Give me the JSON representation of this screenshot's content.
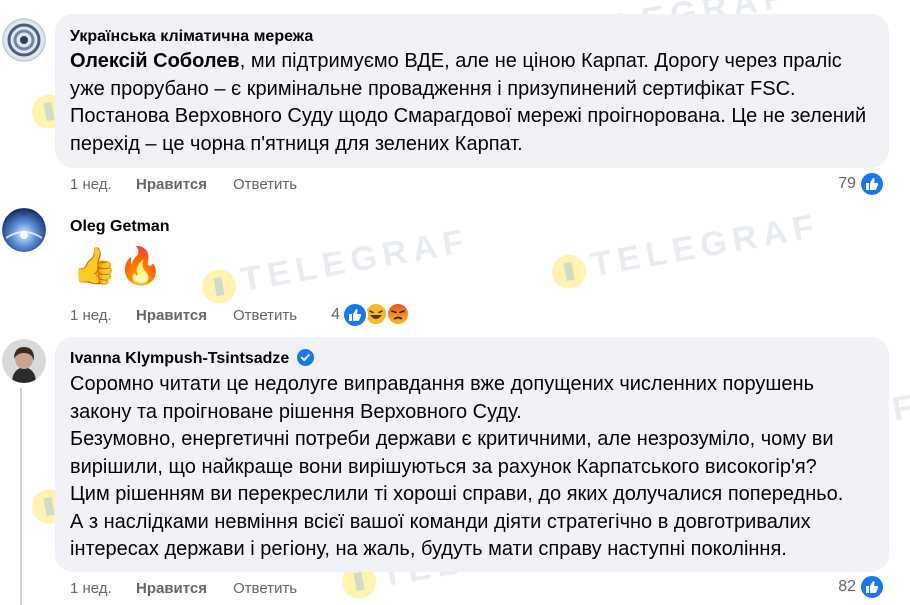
{
  "comments": [
    {
      "author": "Українська кліматична мережа",
      "mention": "Олексій Соболев",
      "text_after_mention": ", ми підтримуємо ВДЕ, але не ціною Карпат. Дорогу через праліс уже прорубано – є кримінальне провадження і призупинений сертифікат FSC. Постанова Верховного Суду щодо Смарагдової мережі проігнорована. Це не зелений перехід – це чорна п'ятниця для зелених Карпат.",
      "time": "1 нед.",
      "like_label": "Нравится",
      "reply_label": "Ответить",
      "reactions_count": "79",
      "reactions": [
        "like-icon"
      ]
    },
    {
      "author": "Oleg Getman",
      "emojis": [
        "👍",
        "🔥"
      ],
      "time": "1 нед.",
      "like_label": "Нравится",
      "reply_label": "Ответить",
      "reactions_count": "4",
      "reactions": [
        "like-icon",
        "haha-icon",
        "angry-icon"
      ]
    },
    {
      "author": "Ivanna Klympush-Tsintsadze",
      "verified": true,
      "paragraphs": [
        "Соромно читати це недолуге виправдання вже допущених численних порушень закону та проігноване рішення Верховного Суду.",
        "Безумовно, енергетичні потреби держави є критичними, але незрозуміло, чому ви вирішили, що найкраще вони вирішуються за рахунок Карпатського високогір'я?",
        "Цим рішенням ви перекреслили ті хороші справи, до яких долучалися попередньо.",
        "А з наслідками невміння всієї вашої команди діяти стратегічно в довготривалих інтересах держави і регіону, на жаль, будуть мати справу наступні покоління."
      ],
      "time": "1 нед.",
      "like_label": "Нравится",
      "reply_label": "Ответить",
      "reactions_count": "82",
      "reactions": [
        "like-icon"
      ]
    }
  ],
  "watermark": {
    "text": "TELEGRAF"
  },
  "colors": {
    "bubble": "#f0f2f5",
    "meta": "#65676b",
    "like_blue": "#1877f2"
  }
}
